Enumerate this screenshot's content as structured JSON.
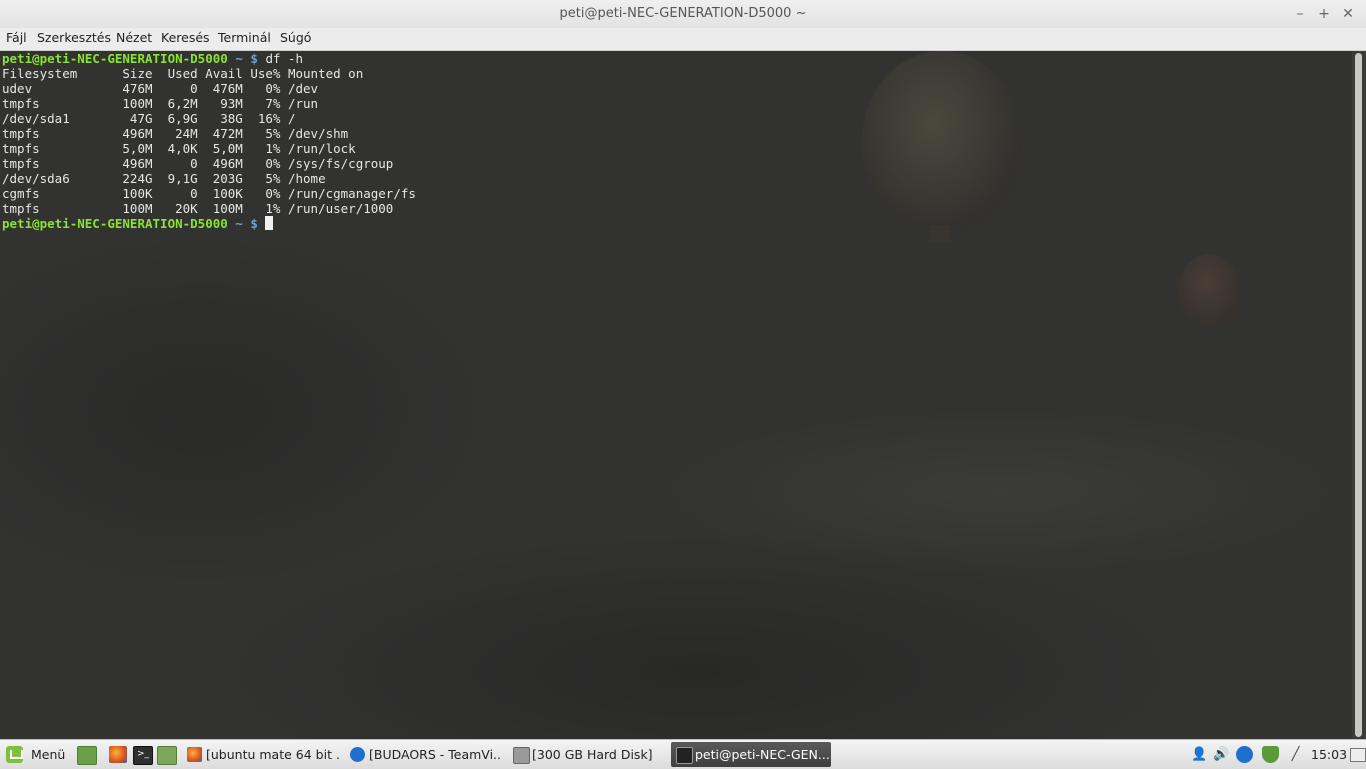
{
  "window": {
    "title": "peti@peti-NEC-GENERATION-D5000 ~",
    "minimize_glyph": "–",
    "maximize_glyph": "+",
    "close_glyph": "✕"
  },
  "menubar": [
    "Fájl",
    "Szerkesztés",
    "Nézet",
    "Keresés",
    "Terminál",
    "Súgó"
  ],
  "terminal": {
    "prompt_user": "peti@peti-NEC-GENERATION-D5000",
    "prompt_path": "~",
    "prompt_symbol": "$",
    "command": "df -h",
    "output": [
      "Filesystem      Size  Used Avail Use% Mounted on",
      "udev            476M     0  476M   0% /dev",
      "tmpfs           100M  6,2M   93M   7% /run",
      "/dev/sda1        47G  6,9G   38G  16% /",
      "tmpfs           496M   24M  472M   5% /dev/shm",
      "tmpfs           5,0M  4,0K  5,0M   1% /run/lock",
      "tmpfs           496M     0  496M   0% /sys/fs/cgroup",
      "/dev/sda6       224G  9,1G  203G   5% /home",
      "cgmfs           100K     0  100K   0% /run/cgmanager/fs",
      "tmpfs           100M   20K  100M   1% /run/user/1000"
    ],
    "text_color": "#e6e6e6",
    "user_color": "#8ae234",
    "path_color": "#729fcf"
  },
  "taskbar": {
    "menu_label": "Menü",
    "launchers": [
      "show-desktop-icon",
      "firefox-icon",
      "terminal-icon",
      "files-icon"
    ],
    "tasks": [
      {
        "label": "[ubuntu mate 64 bit ...",
        "icon": "firefox-icon",
        "active": false
      },
      {
        "label": "[BUDAORS - TeamVi...",
        "icon": "teamviewer-icon",
        "active": false
      },
      {
        "label": "[300 GB Hard Disk]",
        "icon": "disk-icon",
        "active": false
      },
      {
        "label": "peti@peti-NEC-GEN...",
        "icon": "terminal-icon",
        "active": true
      }
    ],
    "tray": [
      "user-icon",
      "volume-icon",
      "teamviewer-icon",
      "shield-icon",
      "network-icon"
    ],
    "clock": "15:03"
  }
}
